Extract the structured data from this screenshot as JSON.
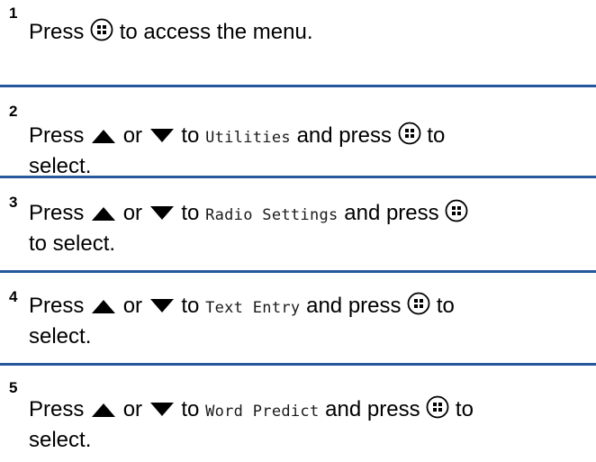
{
  "steps": [
    {
      "number": "1",
      "line1": {
        "before": "Press",
        "after": "to access the menu."
      }
    },
    {
      "number": "2",
      "line1": {
        "before": "Press",
        "or": "or",
        "to": "to",
        "menu": "Utilities",
        "and_press": "and press",
        "tail": "to"
      },
      "line2": "select."
    },
    {
      "number": "3",
      "line1": {
        "before": "Press",
        "or": "or",
        "to": "to",
        "menu": "Radio Settings",
        "and_press": "and press"
      },
      "line2": "to select."
    },
    {
      "number": "4",
      "line1": {
        "before": "Press",
        "or": "or",
        "to": "to",
        "menu": "Text Entry",
        "and_press": "and press",
        "tail": "to"
      },
      "line2": "select."
    },
    {
      "number": "5",
      "line1": {
        "before": "Press",
        "or": "or",
        "to": "to",
        "menu": "Word Predict",
        "and_press": "and press",
        "tail": "to"
      },
      "line2": "select."
    }
  ],
  "icons": {
    "menu_ok": "menu-ok-button-icon",
    "up": "up-arrow-icon",
    "down": "down-arrow-icon"
  },
  "colors": {
    "divider": "#27579d",
    "text": "#000000"
  }
}
